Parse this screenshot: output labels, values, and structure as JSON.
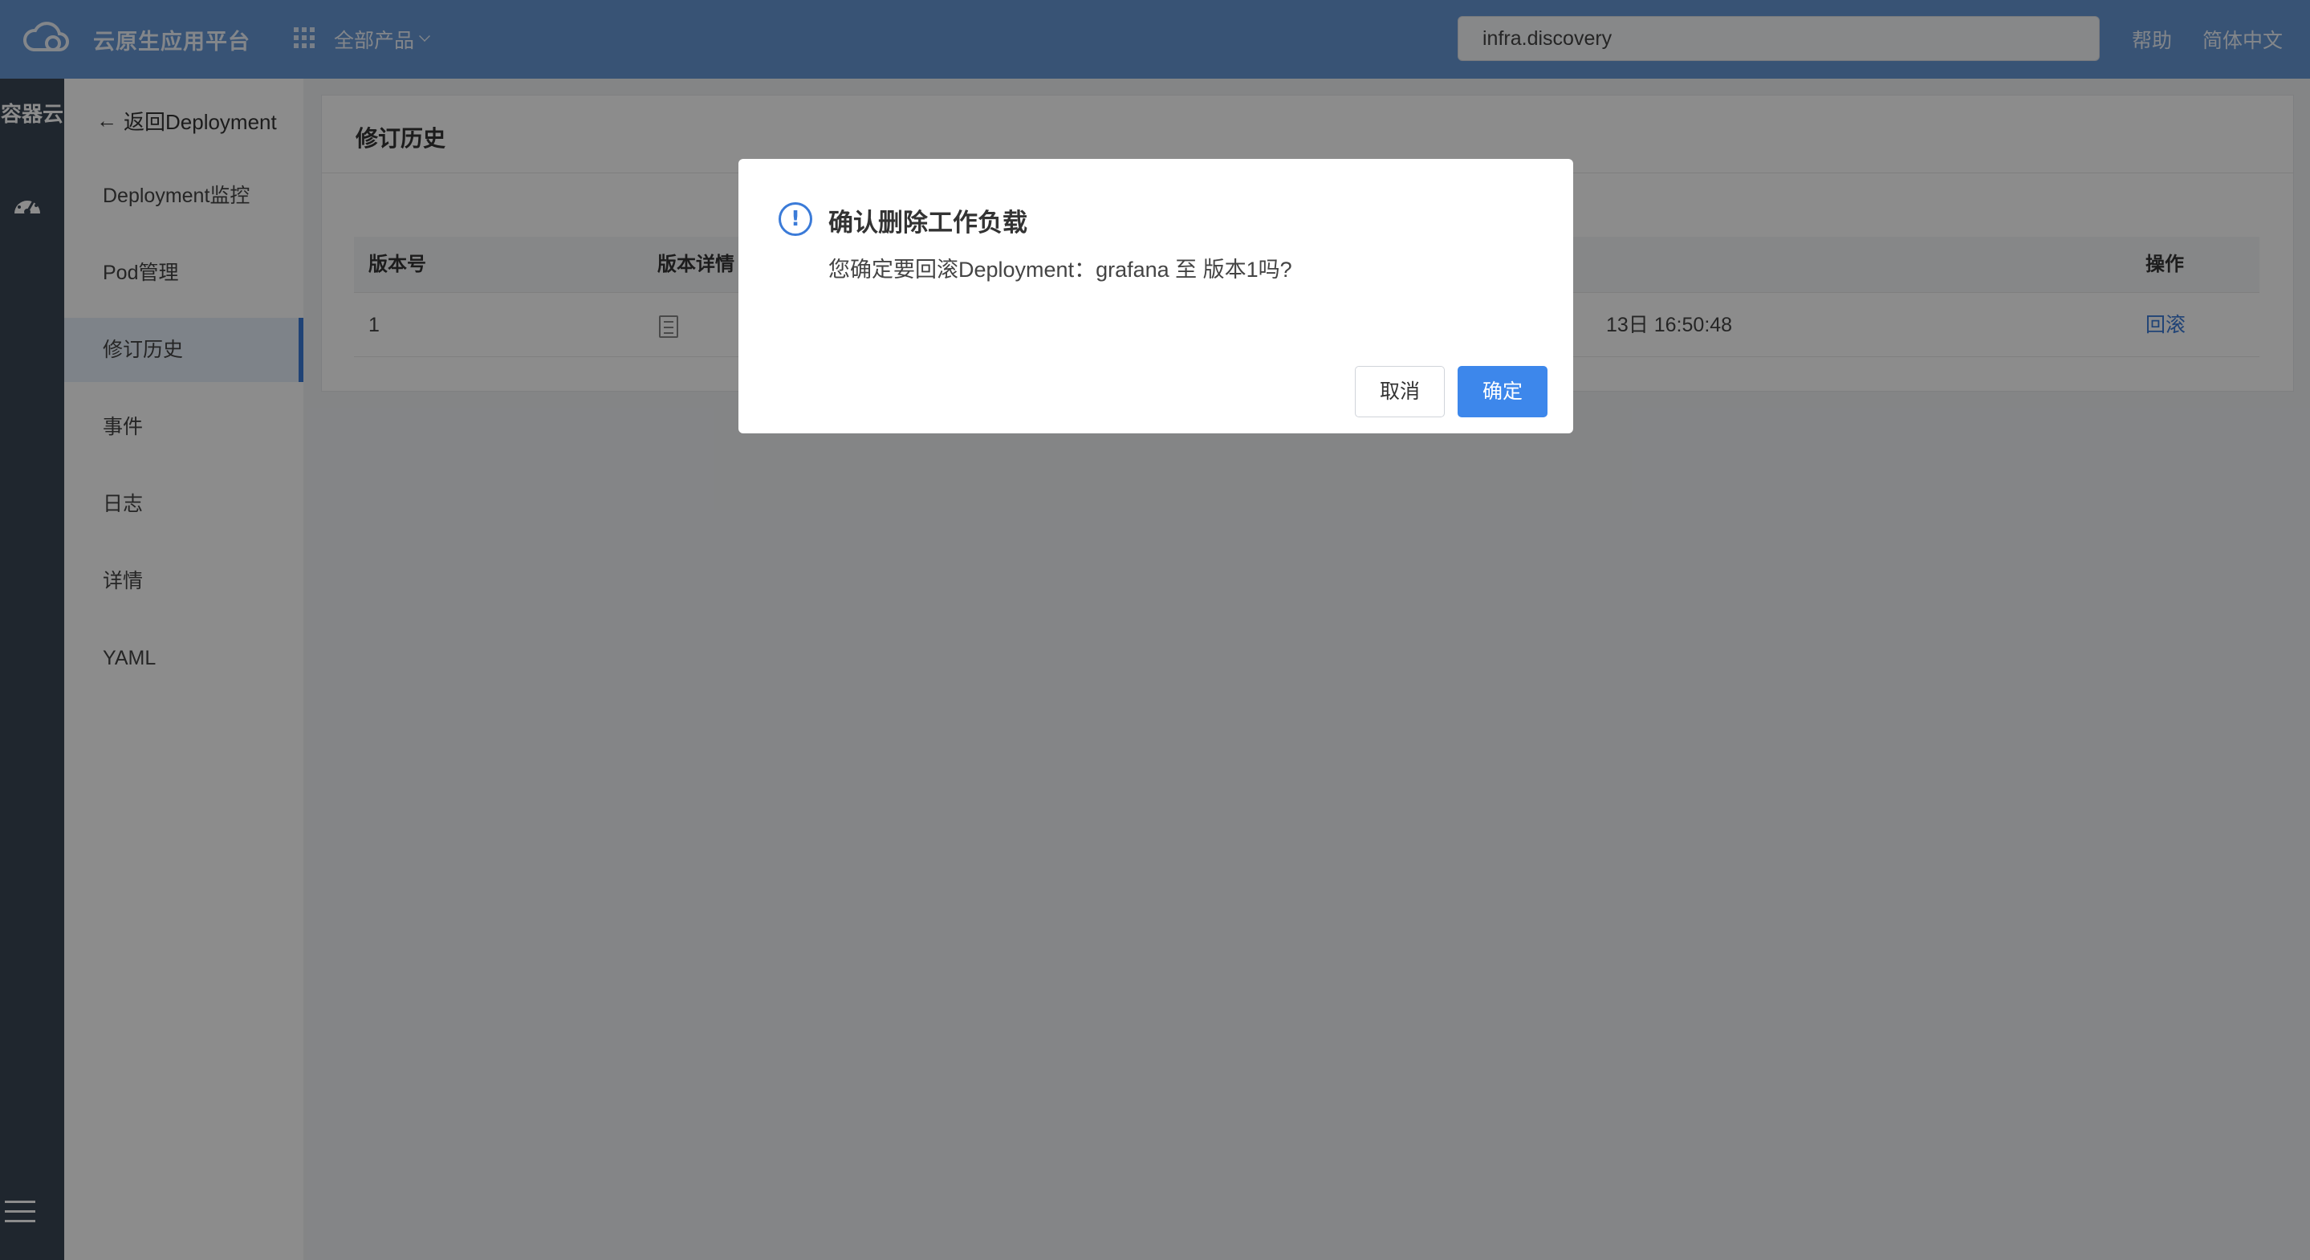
{
  "header": {
    "app_title": "云原生应用平台",
    "all_products": "全部产品",
    "search_value": "infra.discovery",
    "help": "帮助",
    "language": "简体中文"
  },
  "rail": {
    "title": "容器云"
  },
  "subnav": {
    "back": "返回Deployment",
    "items": [
      {
        "label": "Deployment监控"
      },
      {
        "label": "Pod管理"
      },
      {
        "label": "修订历史"
      },
      {
        "label": "事件"
      },
      {
        "label": "日志"
      },
      {
        "label": "详情"
      },
      {
        "label": "YAML"
      }
    ]
  },
  "main": {
    "title": "修订历史",
    "table": {
      "columns": [
        "版本号",
        "版本详情",
        "操作"
      ],
      "rows": [
        {
          "version": "1",
          "created_partial": "13日 16:50:48",
          "action": "回滚"
        }
      ]
    }
  },
  "modal": {
    "title": "确认删除工作负载",
    "message": "您确定要回滚Deployment：grafana 至 版本1吗?",
    "cancel": "取消",
    "confirm": "确定",
    "icon": "!"
  },
  "colors": {
    "header_bg": "#6697d6",
    "rail_bg": "#3a4554",
    "primary": "#3d87eb"
  }
}
